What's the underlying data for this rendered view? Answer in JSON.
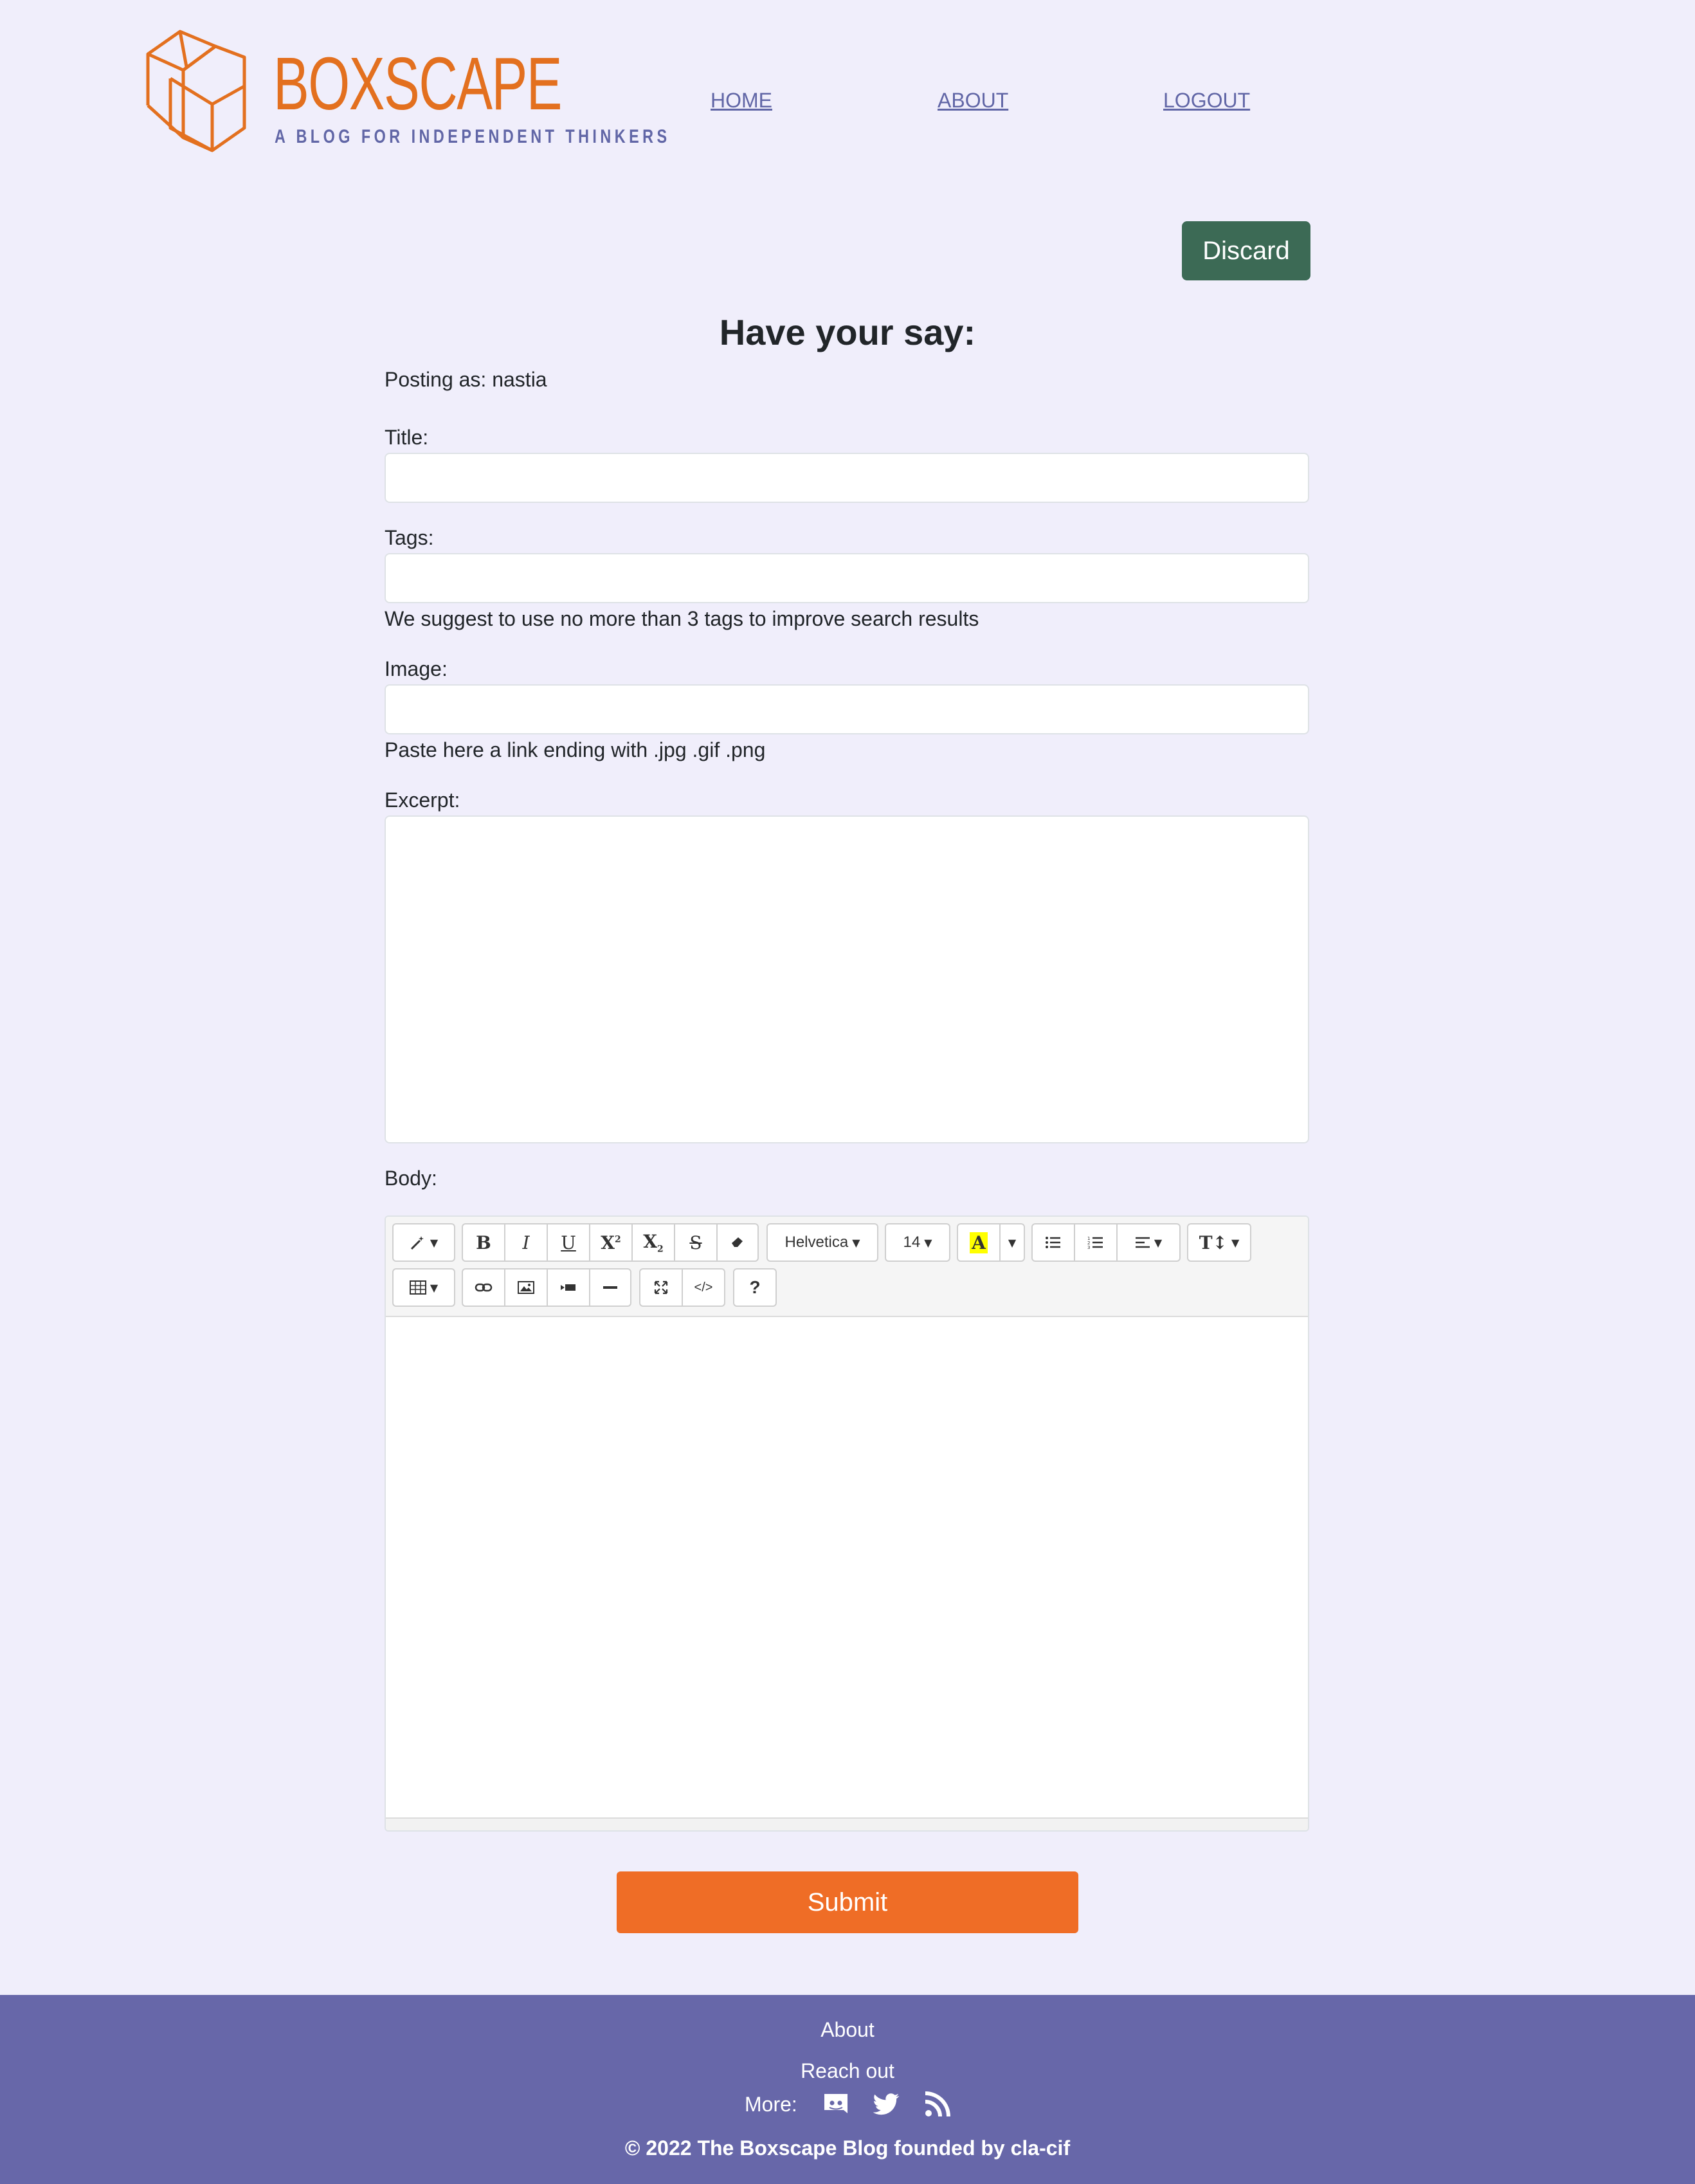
{
  "header": {
    "logo_word": "BOXSCAPE",
    "logo_tagline": "A BLOG FOR INDEPENDENT THINKERS",
    "nav": [
      {
        "label": "HOME"
      },
      {
        "label": "ABOUT"
      },
      {
        "label": "LOGOUT"
      }
    ]
  },
  "actions": {
    "discard_label": "Discard",
    "submit_label": "Submit"
  },
  "form": {
    "title": "Have your say:",
    "posting_as": "Posting as: nastia",
    "title_label": "Title:",
    "title_value": "",
    "tags_label": "Tags:",
    "tags_value": "",
    "tags_help": "We suggest to use no more than 3 tags to improve search results",
    "image_label": "Image:",
    "image_value": "",
    "image_help": "Paste here a link ending with .jpg .gif .png",
    "excerpt_label": "Excerpt:",
    "excerpt_value": "",
    "body_label": "Body:"
  },
  "editor": {
    "font_family": "Helvetica",
    "font_size": "14",
    "toolbar_icons": [
      "magic-icon",
      "bold-icon",
      "italic-icon",
      "underline-icon",
      "superscript-icon",
      "subscript-icon",
      "strikethrough-icon",
      "eraser-icon",
      "highlight-icon",
      "unordered-list-icon",
      "ordered-list-icon",
      "align-icon",
      "text-height-icon",
      "table-icon",
      "link-icon",
      "picture-icon",
      "video-icon",
      "horizontal-rule-icon",
      "fullscreen-icon",
      "code-view-icon",
      "help-icon"
    ]
  },
  "footer": {
    "about": "About",
    "reach_out": "Reach out",
    "more_label": "More:",
    "copyright": "© 2022 The Boxscape Blog founded by cla-cif",
    "icons": [
      "discord-icon",
      "twitter-icon",
      "rss-icon"
    ]
  },
  "colors": {
    "background": "#f0eefb",
    "brand_orange": "#e3701f",
    "nav_purple": "#6166a6",
    "discard_green": "#3c6a55",
    "submit_orange": "#ef6d26",
    "footer_purple": "#6767a9"
  }
}
